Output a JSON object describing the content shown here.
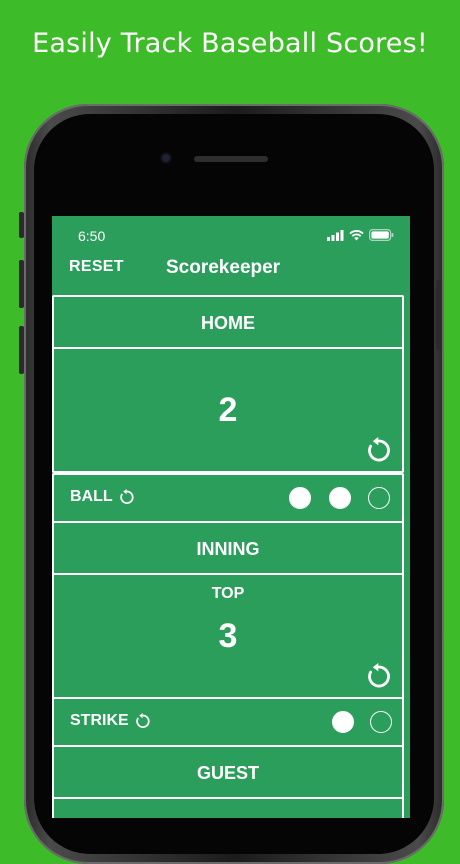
{
  "promo": {
    "headline": "Easily Track Baseball Scores!"
  },
  "status_bar": {
    "time": "6:50"
  },
  "nav": {
    "reset_label": "RESET",
    "title": "Scorekeeper"
  },
  "home": {
    "label": "HOME",
    "score": "2"
  },
  "ball": {
    "label": "BALL",
    "filled": 2,
    "total": 3
  },
  "inning": {
    "label": "INNING",
    "half": "TOP",
    "number": "3"
  },
  "strike": {
    "label": "STRIKE",
    "filled": 1,
    "total": 2
  },
  "guest": {
    "label": "GUEST"
  },
  "colors": {
    "background": "#3dbb28",
    "screen": "#2c9e5c",
    "lines": "#ffffff"
  }
}
